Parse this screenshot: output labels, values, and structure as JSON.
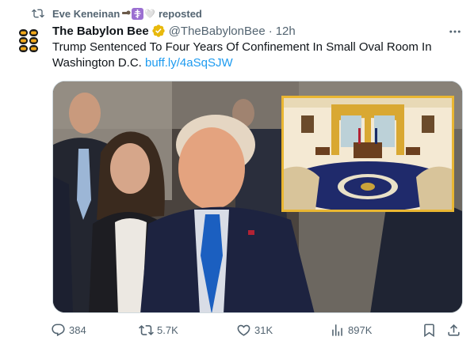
{
  "repost": {
    "user": "Eve Keneinan",
    "suffix": "reposted",
    "icon": "retweet-icon"
  },
  "author": {
    "name": "The Babylon Bee",
    "handle": "@TheBabylonBee",
    "separator": "·",
    "time": "12h",
    "verified_color": "#e8b90d"
  },
  "tweet": {
    "text": "Trump Sentenced To Four Years Of Confinement In Small Oval Room In Washington D.C.",
    "link": "buff.ly/4aSqSJW"
  },
  "actions": {
    "replies": "384",
    "reposts": "5.7K",
    "likes": "31K",
    "views": "897K"
  },
  "colors": {
    "link": "#1d9bf0",
    "muted": "#536471",
    "text": "#0f1419",
    "inset_border": "#e9b632"
  }
}
